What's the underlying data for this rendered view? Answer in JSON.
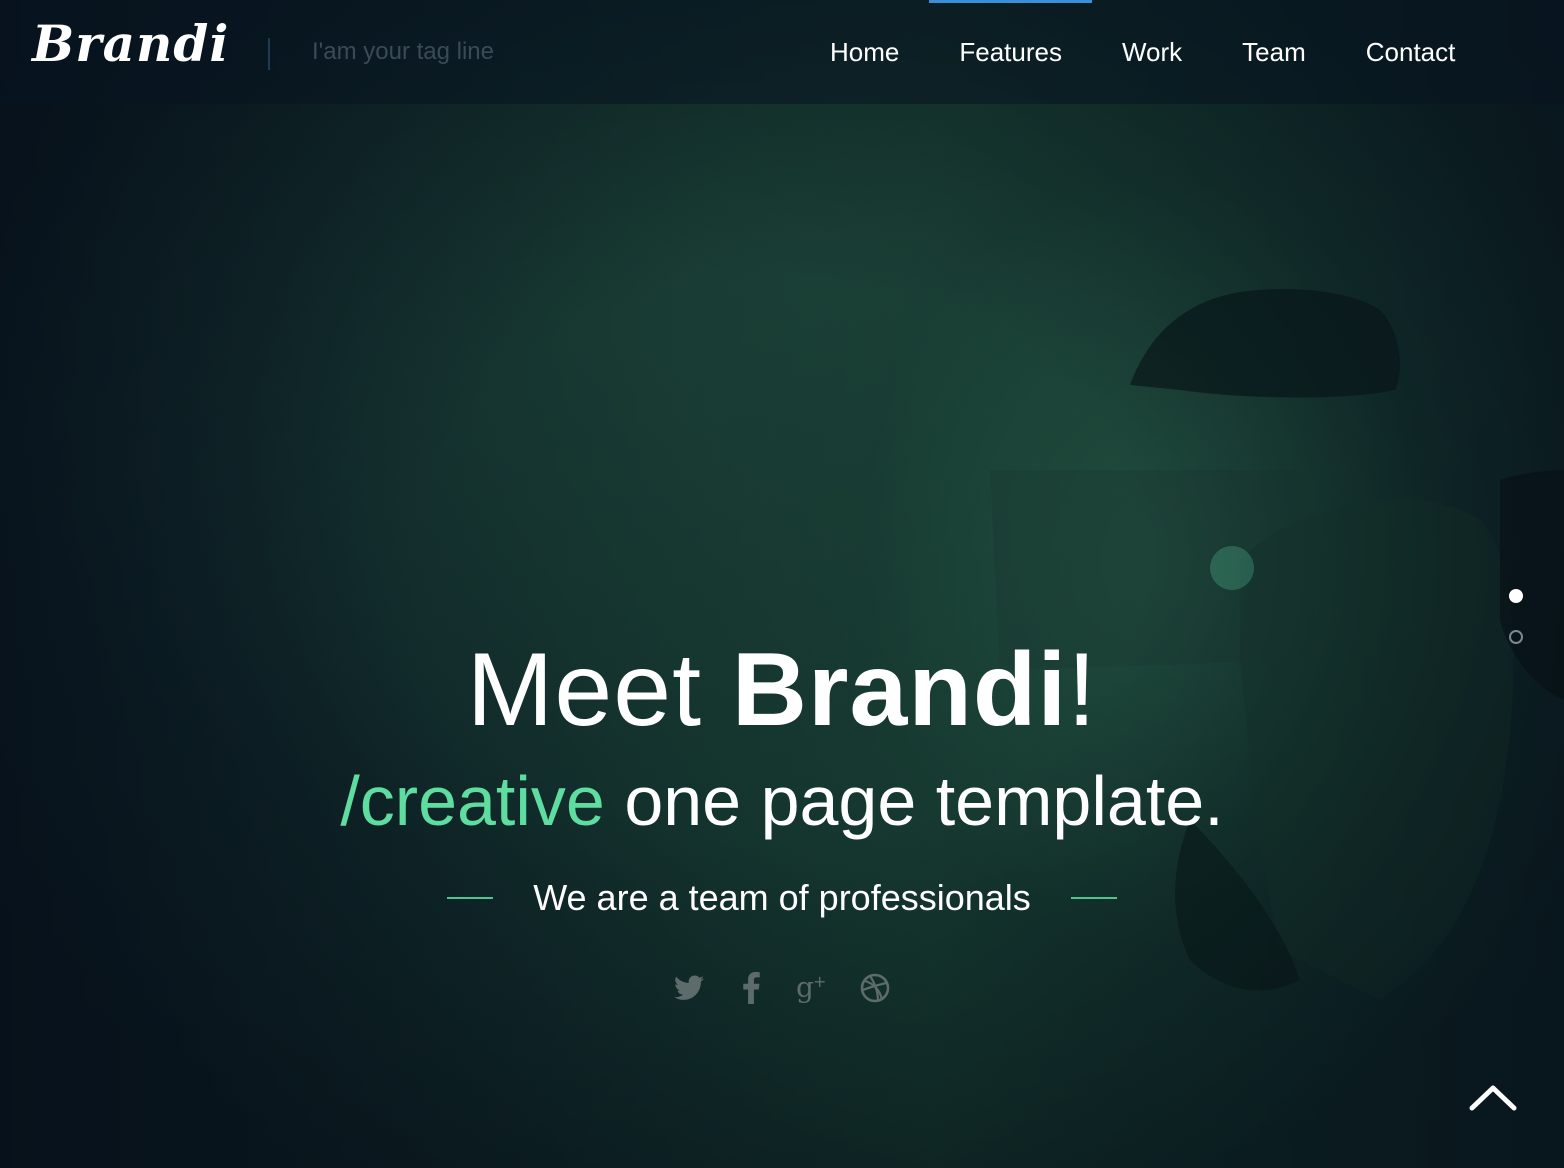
{
  "brand": {
    "logo": "Brandi",
    "tagline": "I'am your tag line"
  },
  "nav": {
    "items": [
      {
        "label": "Home"
      },
      {
        "label": "Features"
      },
      {
        "label": "Work"
      },
      {
        "label": "Team"
      },
      {
        "label": "Contact"
      }
    ],
    "active_label": "Features",
    "active_color": "#3a8fd8"
  },
  "hero": {
    "headline_prefix": "Meet ",
    "headline_strong": "Brandi",
    "headline_suffix": "!",
    "subline_accent": "/creative",
    "subline_rest": " one page template.",
    "team_text": "We are a team of professionals",
    "accent_color": "#5fdca0"
  },
  "slider": {
    "slide_count": 2,
    "active_slide": 1
  },
  "social": {
    "icons": [
      "twitter-icon",
      "facebook-icon",
      "google-plus-icon",
      "dribbble-icon"
    ],
    "icon_color": "#5d6b6b"
  },
  "back_to_top": {
    "icon": "chevron-up-icon"
  }
}
